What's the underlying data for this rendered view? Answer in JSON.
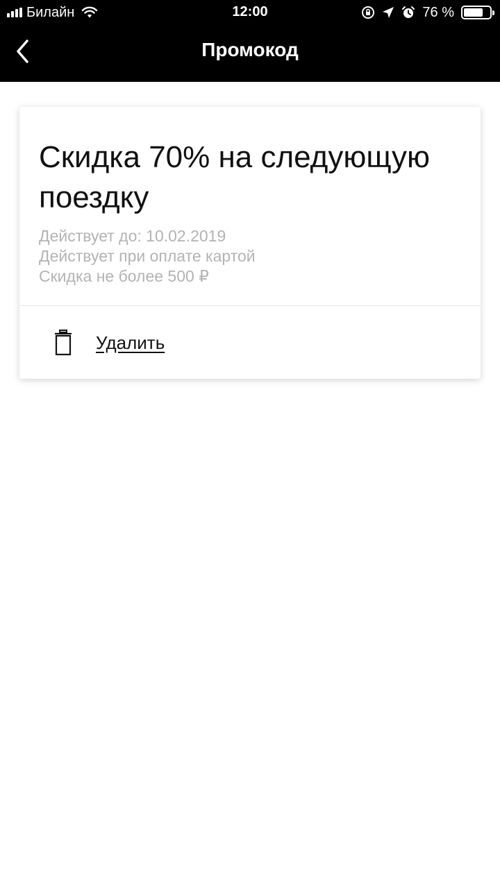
{
  "status_bar": {
    "carrier": "Билайн",
    "time": "12:00",
    "battery_percent": "76 %",
    "battery_level": 0.76
  },
  "nav": {
    "title": "Промокод",
    "back_icon": "chevron-left-icon"
  },
  "promo": {
    "title": "Скидка 70% на следующую поездку",
    "details": [
      "Действует до: 10.02.2019",
      "Действует при оплате картой",
      "Скидка не более 500 ₽"
    ],
    "delete_label": "Удалить",
    "delete_icon": "trash-icon"
  }
}
